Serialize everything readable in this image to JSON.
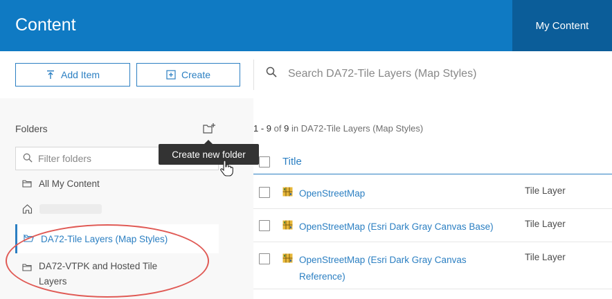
{
  "header": {
    "title": "Content",
    "tab_my_content": "My Content"
  },
  "toolbar": {
    "add_item_label": "Add Item",
    "create_label": "Create",
    "search_placeholder": "Search DA72-Tile Layers (Map Styles)"
  },
  "sidebar": {
    "folders_label": "Folders",
    "filter_placeholder": "Filter folders",
    "tooltip": "Create new folder",
    "items": [
      {
        "label": "All My Content"
      },
      {
        "label": ""
      },
      {
        "label": "DA72-Tile Layers (Map Styles)"
      },
      {
        "label_line1": "DA72-VTPK and Hosted Tile",
        "label_line2": "Layers"
      }
    ]
  },
  "results": {
    "range": "1 - 9",
    "of_word": "of",
    "total": "9",
    "in_text": "in DA72-Tile Layers (Map Styles)"
  },
  "table": {
    "title_header": "Title",
    "rows": [
      {
        "title": "OpenStreetMap",
        "type": "Tile Layer"
      },
      {
        "title": "OpenStreetMap (Esri Dark Gray Canvas Base)",
        "type": "Tile Layer"
      },
      {
        "title_line1": "OpenStreetMap (Esri Dark Gray Canvas",
        "title_line2": "Reference)",
        "type": "Tile Layer"
      }
    ]
  },
  "colors": {
    "header_blue": "#0f7ac3",
    "accent": "#2b7fc2",
    "annotation_red": "#e05a55"
  }
}
